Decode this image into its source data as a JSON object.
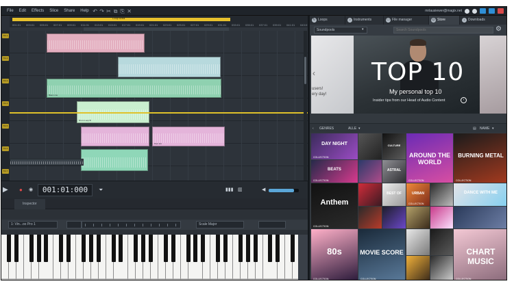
{
  "menubar": {
    "menu_items": [
      "File",
      "Edit",
      "Effects",
      "Slice",
      "Share",
      "Help"
    ],
    "account": "mrlausiewer@magix.net",
    "colors": {
      "minimize": "#2f8fd6",
      "maximize": "#2f8fd6",
      "close": "#d84a4a"
    }
  },
  "arranger": {
    "loop_label": "Loop Area",
    "ruler_numbers": [
      "001:01",
      "003:01",
      "005:01",
      "007:01",
      "009:01",
      "011:01",
      "013:01",
      "015:01",
      "017:01",
      "019:01",
      "021:01",
      "023:01",
      "025:01",
      "027:01",
      "029:01",
      "031:01",
      "033:01",
      "035:01",
      "037:01",
      "039:01",
      "041:01",
      "043:01"
    ],
    "tracks": [
      "Trk 1",
      "Trk 2",
      "Trk 3",
      "Trk 4",
      "Trk 5",
      "Trk 6",
      "Trk 7",
      "Trk 8"
    ],
    "clip_labels": [
      "Drum Loop B",
      "Synth Lead A",
      "Vocal Chop",
      "Bass Line",
      "Perc Hit"
    ],
    "zoom_label": "Zoom + In  1:1  ▢"
  },
  "transport": {
    "time": "001:01:000",
    "volume_fraction": 0.85
  },
  "bottom": {
    "tab_label": "Inspector",
    "instrument": "1: Vin...oo Pro 1",
    "style_field": "Scale Major"
  },
  "right": {
    "tabs": [
      {
        "label": "Loops",
        "icon": "loop-icon"
      },
      {
        "label": "Instruments",
        "icon": "instrument-icon"
      },
      {
        "label": "File manager",
        "icon": "folder-icon"
      },
      {
        "label": "Store",
        "icon": "store-icon"
      },
      {
        "label": "Downloads",
        "icon": "download-icon"
      }
    ],
    "pool_select": "Soundpools",
    "search_placeholder": "Search Soundpools",
    "banner": {
      "title": "TOP 10",
      "subtitle": "My personal top 10",
      "desc": "Insider tips from our Head of Audio Content",
      "left_text": "users!\nery day!"
    },
    "filters": {
      "genres": "GENRES",
      "all": "ALLE",
      "sort": "NAME"
    },
    "tiles": [
      {
        "title": "DAY NIGHT",
        "badge": "COLLECTION"
      },
      {
        "title": "CULTURE",
        "badge": ""
      },
      {
        "title": "AROUND THE WORLD",
        "badge": "COLLECTION"
      },
      {
        "title": "BURNING METAL",
        "badge": "COLLECTION"
      },
      {
        "title": "BEATS",
        "badge": "COLLECTION"
      },
      {
        "title": "ASTRAL",
        "badge": ""
      },
      {
        "title": "BEST OF",
        "badge": ""
      },
      {
        "title": "DANCE WITH ME",
        "badge": ""
      },
      {
        "title": "Anthem",
        "badge": "COLLECTION"
      },
      {
        "title": "URBAN",
        "badge": "COLLECTION"
      },
      {
        "title": "80s",
        "badge": "COLLECTION"
      },
      {
        "title": "MOVIE SCORE",
        "badge": "COLLECTION"
      },
      {
        "title": "CHART MUSIC",
        "badge": "COLLECTION"
      }
    ]
  }
}
